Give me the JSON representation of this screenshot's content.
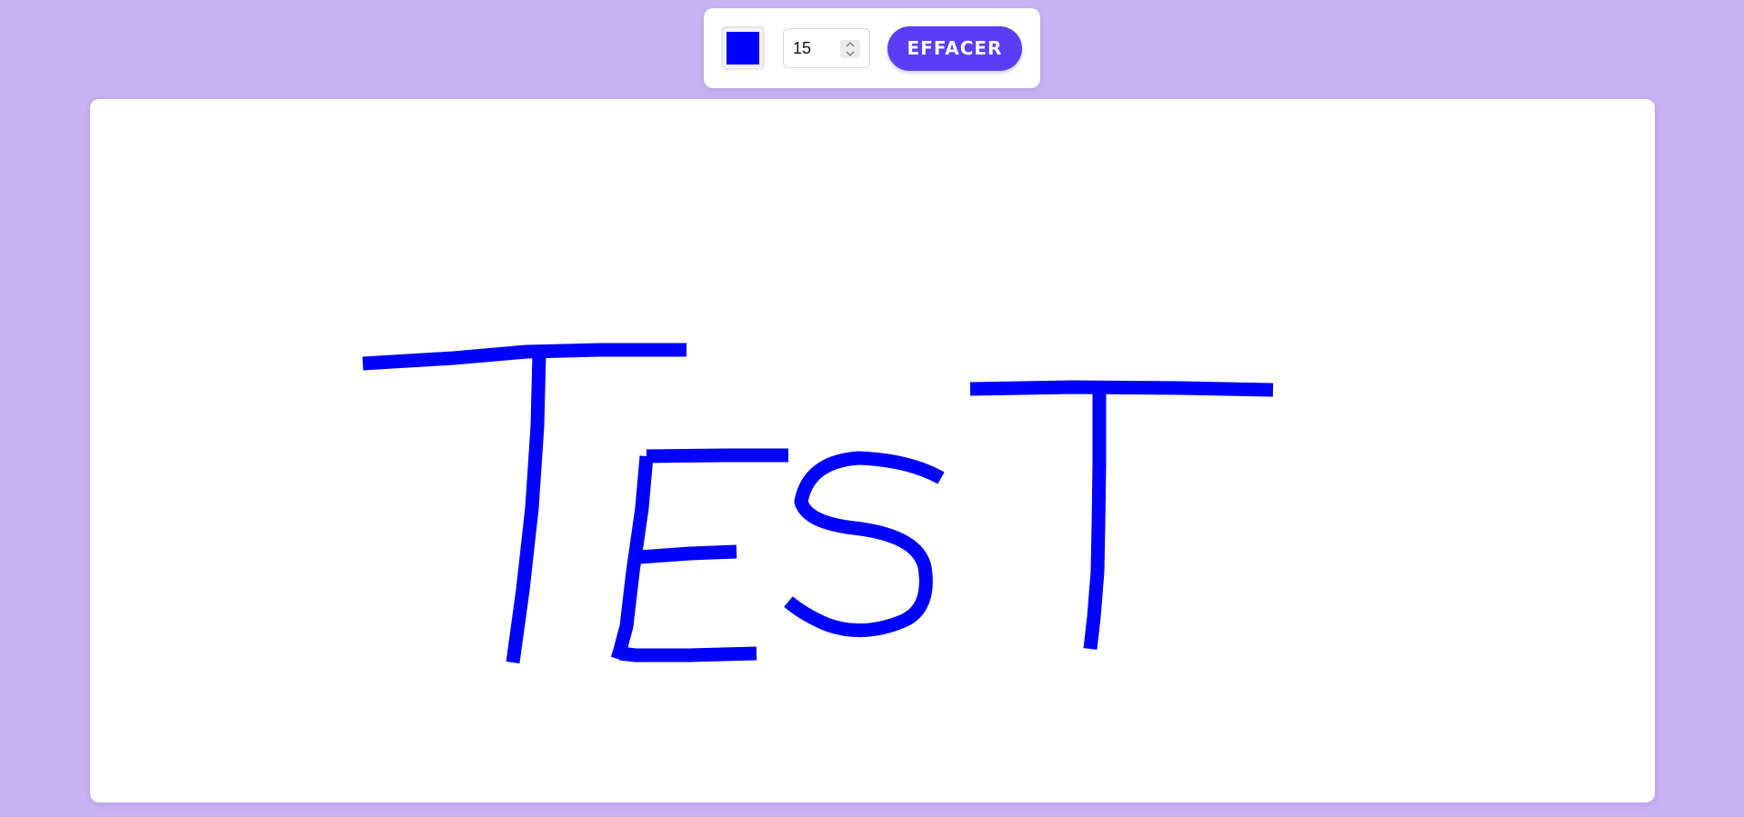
{
  "toolbar": {
    "color": "#0000ff",
    "brush_size": "15",
    "clear_label": "EFFACER"
  },
  "canvas": {
    "stroke_color": "#0000ff",
    "drawn_text": "TEST"
  }
}
